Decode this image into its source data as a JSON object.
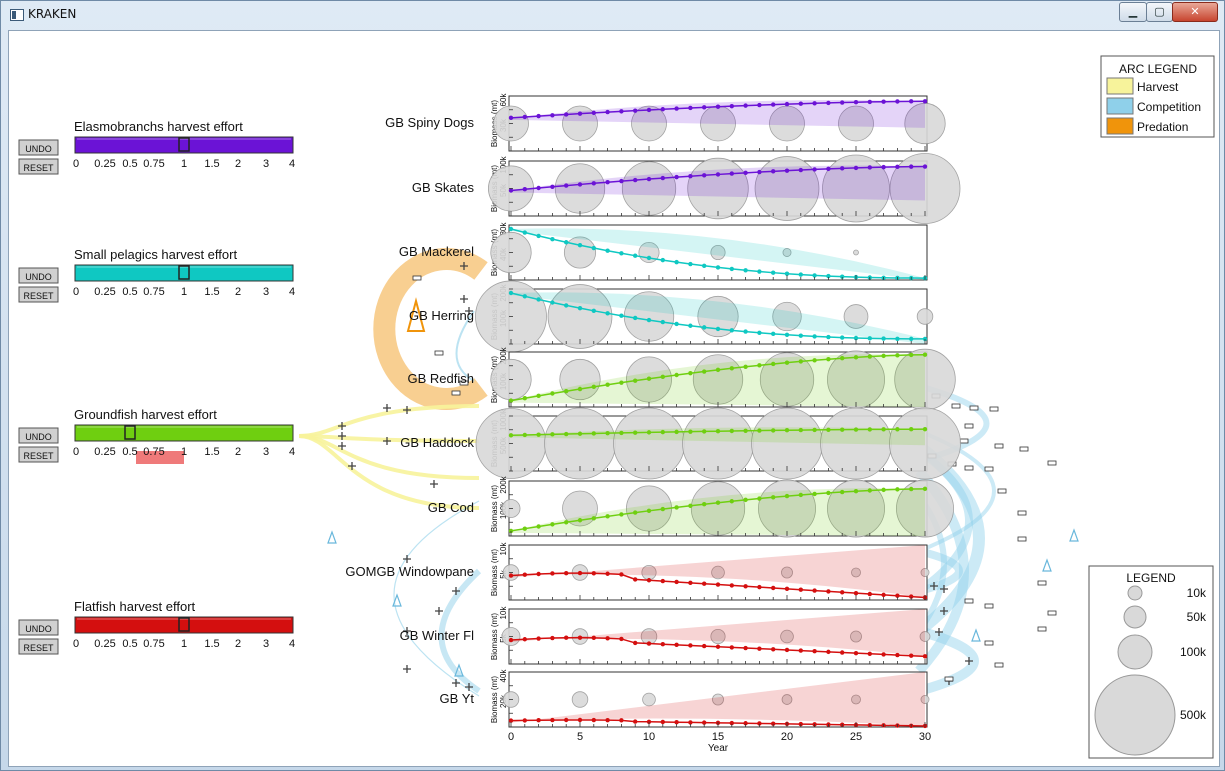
{
  "window": {
    "title": "KRAKEN"
  },
  "colors": {
    "elasmo": "#6b13d6",
    "pelagic": "#0fc8c2",
    "ground": "#6fcf10",
    "flat": "#d40f0f",
    "harvest": "#f7f39b",
    "competition": "#8fd0ea",
    "predation": "#f0940b",
    "bubble": "#d9d9d9"
  },
  "controls": {
    "undo_label": "UNDO",
    "reset_label": "RESET",
    "slider_ticks": [
      "0",
      "0.25",
      "0.5",
      "0.75",
      "1",
      "1.5",
      "2",
      "3",
      "4"
    ],
    "groups": [
      {
        "id": "elasmo",
        "title": "Elasmobranchs  harvest  effort",
        "value": 1
      },
      {
        "id": "pelagic",
        "title": "Small  pelagics  harvest  effort",
        "value": 1
      },
      {
        "id": "ground",
        "title": "Groundfish  harvest  effort",
        "value": 0.5,
        "highlight": "0.75"
      },
      {
        "id": "flat",
        "title": "Flatfish  harvest  effort",
        "value": 1
      }
    ]
  },
  "arc_legend": {
    "title": "ARC  LEGEND",
    "items": [
      {
        "label": "Harvest",
        "color": "#f7f39b"
      },
      {
        "label": "Competition",
        "color": "#8fd0ea"
      },
      {
        "label": "Predation",
        "color": "#f0940b"
      }
    ]
  },
  "size_legend": {
    "title": "LEGEND",
    "items": [
      "10k",
      "50k",
      "100k",
      "500k"
    ]
  },
  "x_axis": {
    "label": "Year",
    "ticks": [
      "0",
      "5",
      "10",
      "15",
      "20",
      "25",
      "30"
    ]
  },
  "y_axis_label": "Biomass  (mt)",
  "chart_data": [
    {
      "type": "line",
      "species": "GB  Spiny  Dogs",
      "group": "elasmo",
      "yticks": [
        "30k",
        "60k"
      ],
      "ylim": [
        0,
        60000
      ],
      "x": [
        0,
        30
      ],
      "y": [
        39000,
        58500
      ],
      "bubbles": [
        15000,
        15000,
        15000,
        15000,
        15000,
        15000,
        20000
      ]
    },
    {
      "type": "line",
      "species": "GB  Skates",
      "group": "elasmo",
      "yticks": [
        "50k",
        "100k"
      ],
      "ylim": [
        0,
        100000
      ],
      "x": [
        0,
        30
      ],
      "y": [
        50000,
        97000
      ],
      "bubbles": [
        25000,
        30000,
        35000,
        45000,
        50000,
        55000,
        60000
      ]
    },
    {
      "type": "line",
      "species": "GB  Mackerel",
      "group": "pelagic",
      "yticks": [
        "40k",
        "80k"
      ],
      "ylim": [
        0,
        80000
      ],
      "x": [
        0,
        30
      ],
      "y": [
        80000,
        3000
      ],
      "bubbles": [
        20000,
        12000,
        5000,
        2500,
        800,
        300,
        0
      ]
    },
    {
      "type": "line",
      "species": "GB  Herring",
      "group": "pelagic",
      "yticks": [
        "100k",
        "200k"
      ],
      "ylim": [
        0,
        200000
      ],
      "x": [
        0,
        30
      ],
      "y": [
        200000,
        20000
      ],
      "bubbles": [
        90000,
        50000,
        30000,
        20000,
        10000,
        7000,
        3000
      ]
    },
    {
      "type": "line",
      "species": "GB  Redfish",
      "group": "ground",
      "yticks": [
        "100k",
        "200k"
      ],
      "ylim": [
        0,
        200000
      ],
      "x": [
        0,
        30
      ],
      "y": [
        25000,
        205000
      ],
      "bubbles": [
        20000,
        20000,
        25000,
        30000,
        35000,
        40000,
        45000
      ]
    },
    {
      "type": "line",
      "species": "GB  Haddock",
      "group": "ground",
      "yticks": [
        "500k",
        "1000k"
      ],
      "ylim": [
        0,
        1000000
      ],
      "x": [
        0,
        30
      ],
      "y": [
        700000,
        820000
      ],
      "bubbles": [
        60000,
        140000,
        120000,
        110000,
        110000,
        100000,
        90000
      ]
    },
    {
      "type": "line",
      "species": "GB  Cod",
      "group": "ground",
      "yticks": [
        "100k",
        "200k"
      ],
      "ylim": [
        0,
        200000
      ],
      "x": [
        0,
        30
      ],
      "y": [
        20000,
        185000
      ],
      "bubbles": [
        4000,
        15000,
        25000,
        35000,
        40000,
        40000,
        40000
      ]
    },
    {
      "type": "line",
      "species": "GOMGB  Windowpane",
      "group": "flat",
      "yticks": [
        "5k",
        "10k"
      ],
      "ylim": [
        0,
        10000
      ],
      "x": [
        0,
        30
      ],
      "y": [
        4800,
        500
      ],
      "bubbles": [
        3000,
        3000,
        2500,
        2000,
        1500,
        1000,
        800
      ]
    },
    {
      "type": "line",
      "species": "GB  Winter  Fl",
      "group": "flat",
      "yticks": [
        "5k",
        "10k"
      ],
      "ylim": [
        0,
        10000
      ],
      "x": [
        0,
        30
      ],
      "y": [
        4700,
        1500
      ],
      "bubbles": [
        4000,
        3000,
        3000,
        2500,
        2000,
        1500,
        1200
      ]
    },
    {
      "type": "line",
      "species": "GB  Yt",
      "group": "flat",
      "yticks": [
        "20k",
        "40k"
      ],
      "ylim": [
        0,
        40000
      ],
      "x": [
        0,
        30
      ],
      "y": [
        5000,
        800
      ],
      "bubbles": [
        3000,
        3000,
        2000,
        1500,
        1200,
        1000,
        800
      ]
    }
  ]
}
